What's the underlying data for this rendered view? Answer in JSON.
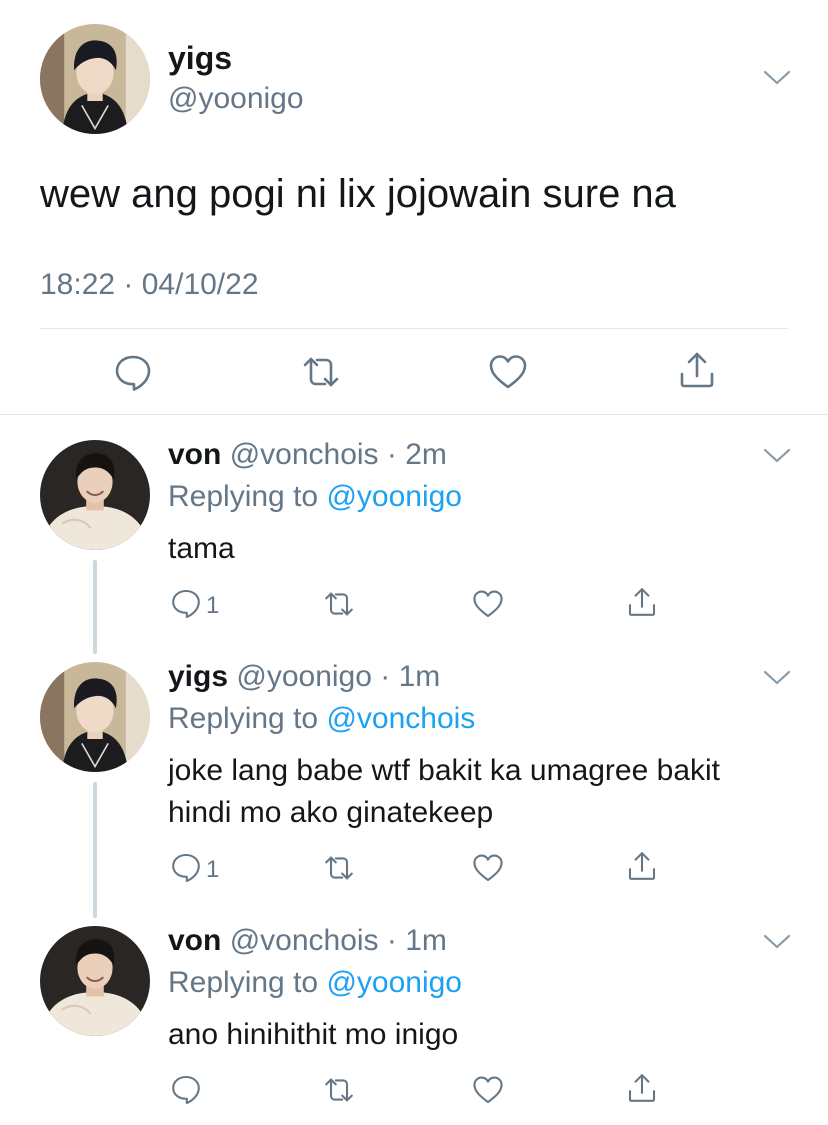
{
  "main_tweet": {
    "display_name": "yigs",
    "handle": "@yoonigo",
    "text": "wew ang pogi ni lix jojowain sure na",
    "timestamp": "18:22 · 04/10/22"
  },
  "replies": [
    {
      "display_name": "von",
      "meta": "@vonchois · 2m",
      "replying_label": "Replying to",
      "replying_to": "@yoonigo",
      "text": "tama",
      "reply_count": "1"
    },
    {
      "display_name": "yigs",
      "meta": "@yoonigo · 1m",
      "replying_label": "Replying to",
      "replying_to": "@vonchois",
      "text_line1": "joke lang babe wtf bakit ka umagree bakit",
      "text_line2": "hindi mo ako ginatekeep",
      "reply_count": "1"
    },
    {
      "display_name": "von",
      "meta": "@vonchois · 1m",
      "replying_label": "Replying to",
      "replying_to": "@yoonigo",
      "text": "ano hinihithit mo inigo"
    }
  ],
  "colors": {
    "link": "#1da1f2",
    "secondary": "#657786",
    "divider": "#e1e8ed",
    "thread": "#ccd6dd"
  },
  "icons": [
    "chevron-down-icon",
    "reply-icon",
    "retweet-icon",
    "like-icon",
    "share-icon"
  ]
}
